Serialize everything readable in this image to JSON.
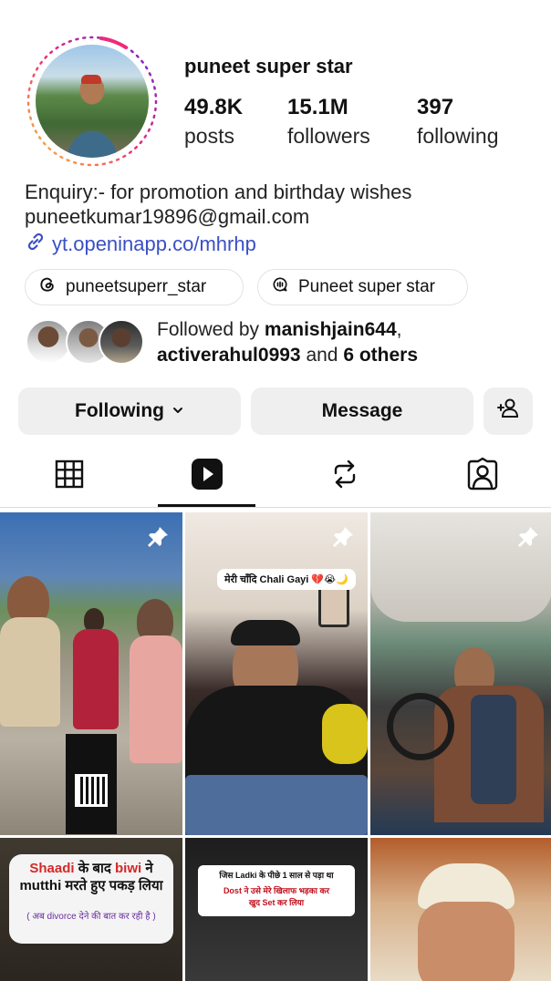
{
  "profile": {
    "username": "puneet super star",
    "stats": {
      "posts_count": "49.8K",
      "posts_label": "posts",
      "followers_count": "15.1M",
      "followers_label": "followers",
      "following_count": "397",
      "following_label": "following"
    },
    "bio": {
      "line1": "Enquiry:-  for promotion and birthday wishes",
      "line2": "puneetkumar19896@gmail.com",
      "link": "yt.openinapp.co/mhrhp"
    },
    "chips": {
      "threads": "puneetsuperr_star",
      "channel": "Puneet super star"
    },
    "followed_by": {
      "prefix": "Followed by ",
      "user1": "manishjain644",
      "sep": ",",
      "user2": "activerahul0993",
      "and": " and ",
      "others": "6 others"
    }
  },
  "actions": {
    "following_label": "Following",
    "message_label": "Message"
  },
  "tabs": [
    {
      "name": "grid",
      "icon": "grid-icon",
      "active": false
    },
    {
      "name": "reels",
      "icon": "reels-icon",
      "active": true
    },
    {
      "name": "reposts",
      "icon": "repost-icon",
      "active": false
    },
    {
      "name": "tagged",
      "icon": "tagged-icon",
      "active": false
    }
  ],
  "grid": {
    "post2_sticker": "मेरी चाँदि Chali Gayi 💔😭🌙",
    "post4": {
      "line1_red": "Shaadi",
      "line1_mid": " के बाद ",
      "line1_end": "biwi",
      "line1_tail": " ने",
      "line2": "mutthi मरते हुए पकड़ लिया",
      "line3": "( अब divorce देने की बात कर रही है )"
    },
    "post5": {
      "line1": "जिस Ladki के पीछे 1 साल से पड़ा था",
      "line2": "Dost ने उसे मेरे खिलाफ भड़का कर",
      "line3": "खुद Set कर लिया"
    }
  },
  "colors": {
    "link": "#3a4fc4",
    "button_bg": "#efefef",
    "story_ring_start": "#f9ce34",
    "story_ring_mid": "#ee2a7b",
    "story_ring_end": "#6228d7"
  }
}
